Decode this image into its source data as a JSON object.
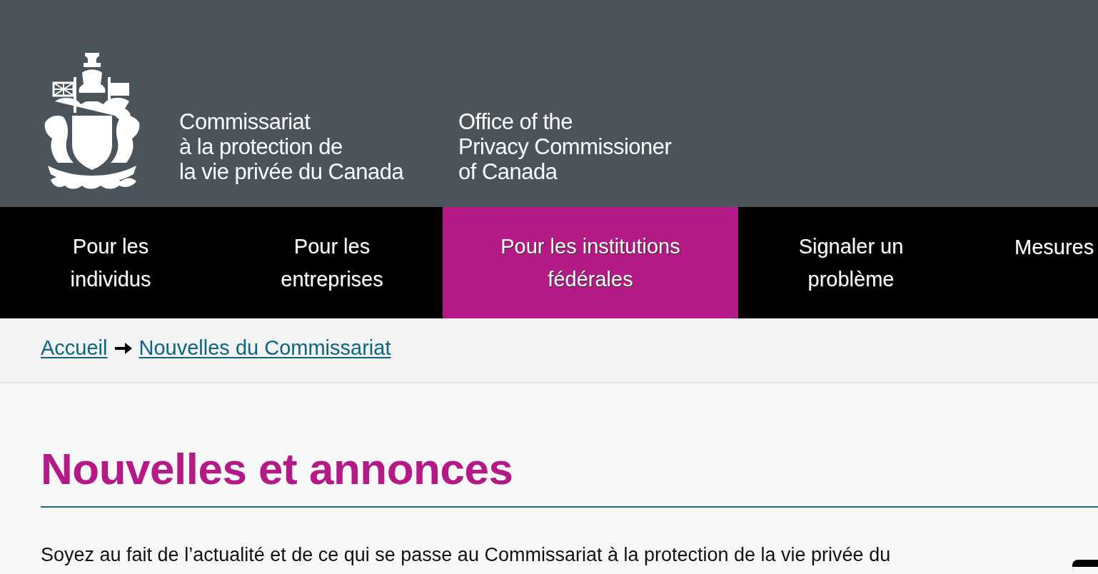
{
  "header": {
    "name_fr": "Commissariat\nà la protection de\nla vie privée du Canada",
    "name_en": "Office of the\nPrivacy Commissioner\nof Canada"
  },
  "nav": [
    {
      "label": "Pour les\nindividus",
      "selected": false
    },
    {
      "label": "Pour les\nentreprises",
      "selected": false
    },
    {
      "label": "Pour les institutions\nfédérales",
      "selected": true
    },
    {
      "label": "Signaler un\nproblème",
      "selected": false
    },
    {
      "label": "Mesures",
      "selected": false
    }
  ],
  "breadcrumb": [
    "Accueil",
    "Nouvelles du Commissariat"
  ],
  "main": {
    "title": "Nouvelles et annonces",
    "intro": "Soyez au fait de l’actualité et de ce qui se passe au Commissariat à la protection de la vie privée du"
  }
}
